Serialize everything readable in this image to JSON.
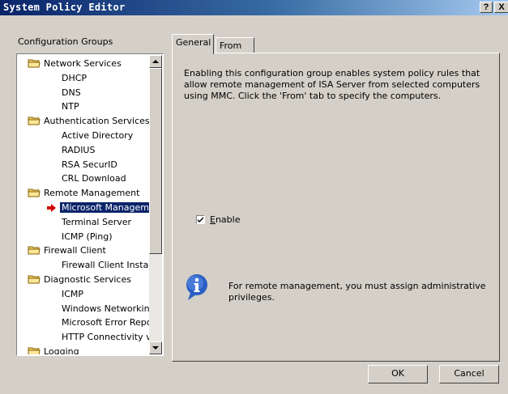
{
  "window": {
    "title": "System Policy Editor",
    "help": "?",
    "close": "X"
  },
  "groups_label": "Configuration Groups",
  "tree": {
    "items": [
      {
        "label": "Network Services",
        "kind": "group"
      },
      {
        "label": "DHCP",
        "kind": "child"
      },
      {
        "label": "DNS",
        "kind": "child"
      },
      {
        "label": "NTP",
        "kind": "child"
      },
      {
        "label": "Authentication Services",
        "kind": "group"
      },
      {
        "label": "Active Directory",
        "kind": "child"
      },
      {
        "label": "RADIUS",
        "kind": "child"
      },
      {
        "label": "RSA SecurID",
        "kind": "child"
      },
      {
        "label": "CRL Download",
        "kind": "child"
      },
      {
        "label": "Remote Management",
        "kind": "group"
      },
      {
        "label": "Microsoft Manageme",
        "kind": "child",
        "selected": true
      },
      {
        "label": "Terminal Server",
        "kind": "child"
      },
      {
        "label": "ICMP (Ping)",
        "kind": "child"
      },
      {
        "label": "Firewall Client",
        "kind": "group"
      },
      {
        "label": "Firewall Client Install",
        "kind": "child"
      },
      {
        "label": "Diagnostic Services",
        "kind": "group"
      },
      {
        "label": "ICMP",
        "kind": "child"
      },
      {
        "label": "Windows Networking",
        "kind": "child"
      },
      {
        "label": "Microsoft Error Repo",
        "kind": "child"
      },
      {
        "label": "HTTP Connectivity ve",
        "kind": "child"
      },
      {
        "label": "Logging",
        "kind": "group"
      }
    ]
  },
  "tabs": [
    {
      "label": "General",
      "active": true
    },
    {
      "label": "From",
      "active": false
    }
  ],
  "general": {
    "description": "Enabling this configuration group enables system policy rules that allow remote management of ISA Server from selected computers using MMC. Click the 'From' tab to specify the computers.",
    "enable_label": "Enable",
    "enable_checked": true,
    "info_text": "For remote management, you must assign administrative privileges."
  },
  "buttons": {
    "ok": "OK",
    "cancel": "Cancel"
  },
  "colors": {
    "selection": "#0a246a",
    "title_start": "#0a246a",
    "title_end": "#a6caf0",
    "arrow": "#d40000"
  }
}
